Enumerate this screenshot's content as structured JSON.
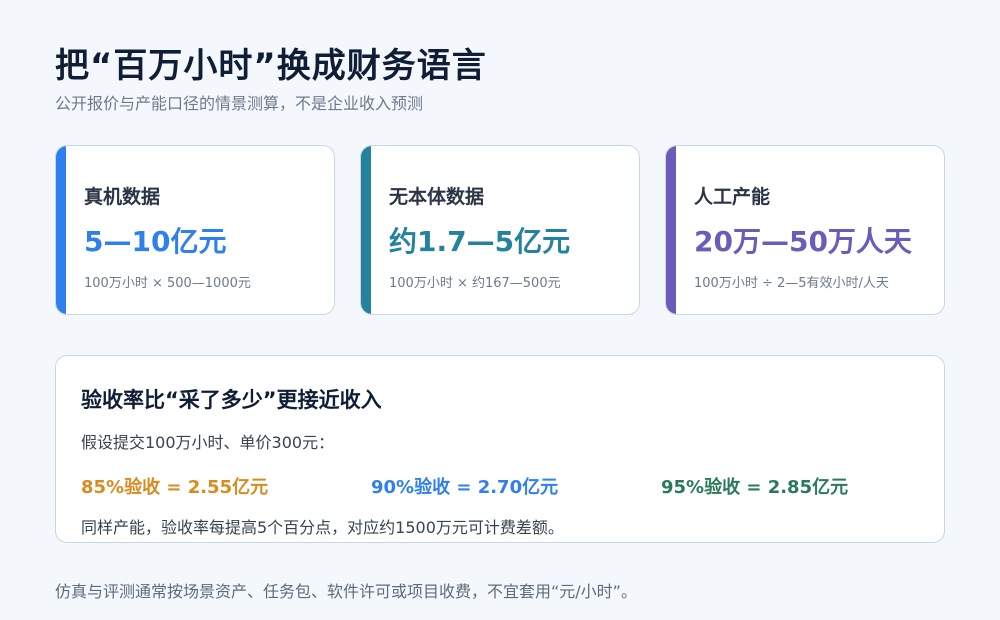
{
  "header": {
    "title": "把“百万小时”换成财务语言",
    "subtitle": "公开报价与产能口径的情景测算，不是企业收入预测"
  },
  "cards": [
    {
      "title": "真机数据",
      "value": "5—10亿元",
      "note": "100万小时 × 500—1000元",
      "accent": "#2f80ed"
    },
    {
      "title": "无本体数据",
      "value": "约1.7—5亿元",
      "note": "100万小时 × 约167—500元",
      "accent": "#23839e"
    },
    {
      "title": "人工产能",
      "value": "20万—50万人天",
      "note": "100万小时 ÷ 2—5有效小时/人天",
      "accent": "#6a5cb8"
    }
  ],
  "acceptance": {
    "title": "验收率比“采了多少”更接近收入",
    "premise": "假设提交100万小时、单价300元：",
    "scenarios": [
      {
        "label": "85%验收 = 2.55亿元",
        "color": "#d98b1f"
      },
      {
        "label": "90%验收 = 2.70亿元",
        "color": "#2f80ed"
      },
      {
        "label": "95%验收 = 2.85亿元",
        "color": "#2a7a5a"
      }
    ],
    "note": "同样产能，验收率每提高5个百分点，对应约1500万元可计费差额。"
  },
  "footer": {
    "text": "仿真与评测通常按场景资产、任务包、软件许可或项目收费，不宜套用“元/小时”。"
  }
}
